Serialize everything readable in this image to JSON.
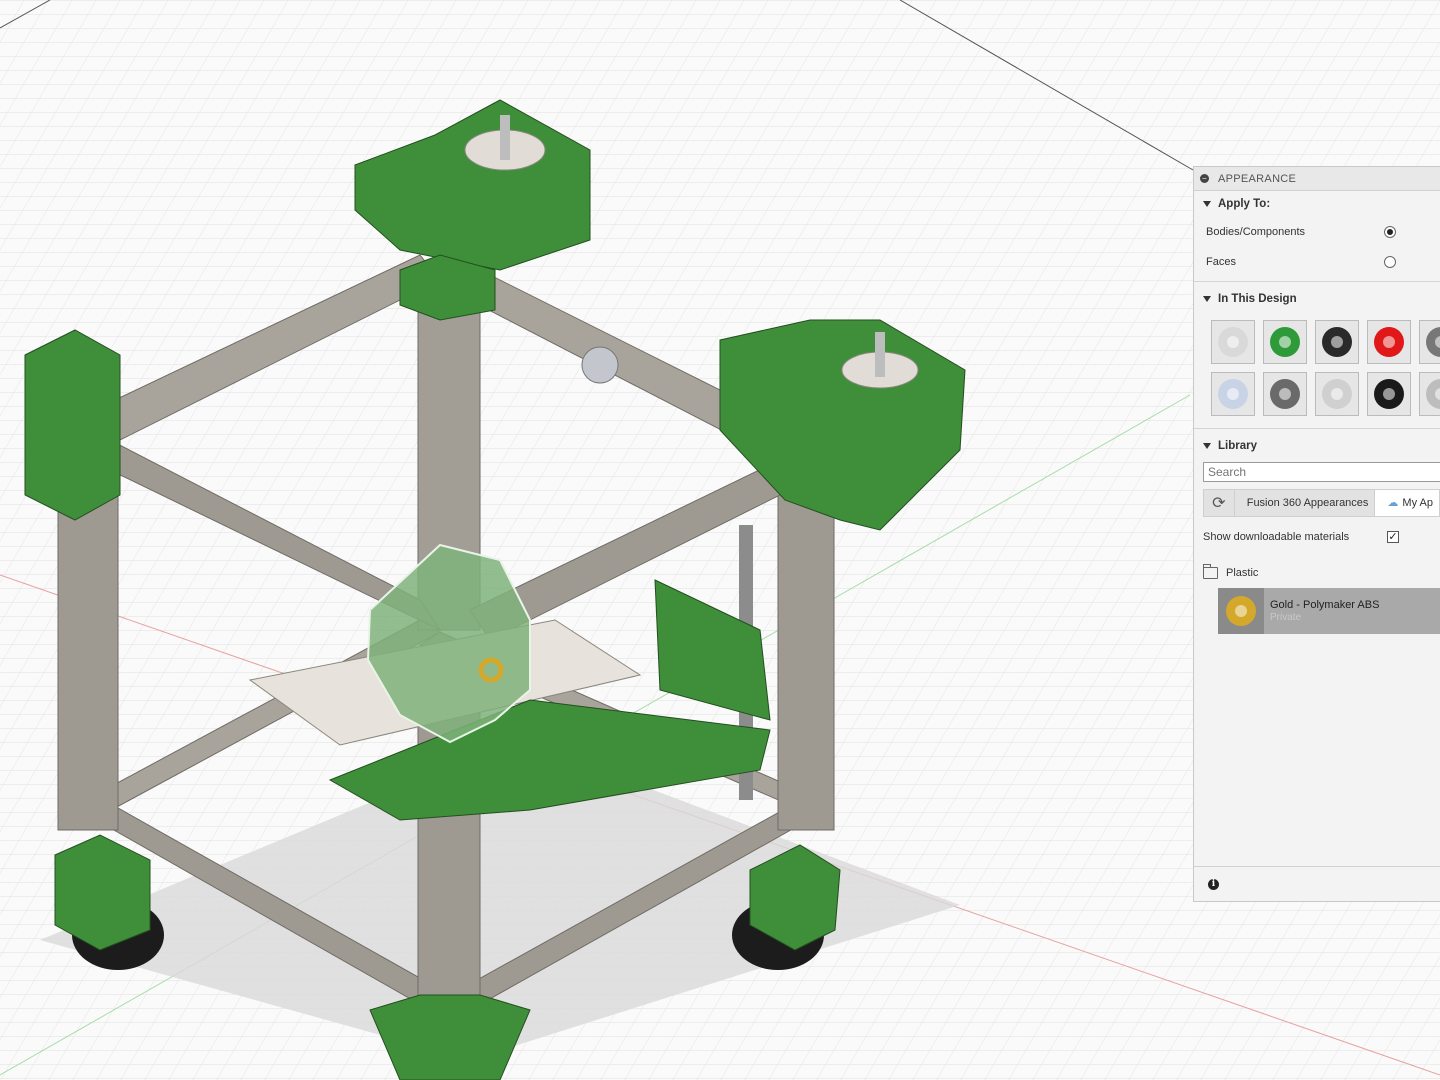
{
  "panel": {
    "title": "APPEARANCE",
    "apply_to": {
      "heading": "Apply To:",
      "options": [
        {
          "label": "Bodies/Components",
          "selected": true
        },
        {
          "label": "Faces",
          "selected": false
        }
      ]
    },
    "in_this_design": {
      "heading": "In This Design",
      "swatch_colors": [
        "#d9d9d9",
        "#2f9a3a",
        "#2a2a2a",
        "#e01818",
        "#777777",
        "#c9d3e6",
        "#6a6a6a",
        "#d0d0d0",
        "#1a1a1a",
        "#bdbdbd"
      ]
    },
    "library": {
      "heading": "Library",
      "search_placeholder": "Search",
      "tabs": [
        "Fusion 360 Appearances",
        "My Ap"
      ],
      "show_downloadable_label": "Show downloadable materials",
      "show_downloadable_checked": true,
      "folder": "Plastic",
      "selected_material": {
        "name": "Gold - Polymaker ABS",
        "sub": "Private",
        "color": "#d4a82a"
      }
    },
    "icons": {
      "collapse": "minus-icon",
      "refresh": "refresh-icon",
      "cloud": "cloud-icon",
      "folder": "folder-icon",
      "info": "info-icon"
    }
  },
  "colors": {
    "frame_green": "#3f8f3a",
    "frame_green_dark": "#2f6f2c",
    "extrusion": "#9e9a92",
    "selected_green": "#7fb17a",
    "plate": "#e7e3dc",
    "rubber_feet": "#1c1c1c"
  }
}
